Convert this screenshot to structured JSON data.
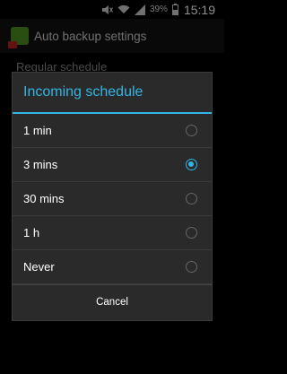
{
  "status_bar": {
    "battery_percent": "39%",
    "time": "15:19",
    "icons": [
      "mute-icon",
      "wifi-icon",
      "signal-icon",
      "battery-icon"
    ]
  },
  "action_bar": {
    "title": "Auto backup settings",
    "icon": "app-icon"
  },
  "background": {
    "item": "Regular schedule"
  },
  "dialog": {
    "title": "Incoming schedule",
    "options": [
      {
        "label": "1 min",
        "selected": false
      },
      {
        "label": "3 mins",
        "selected": true
      },
      {
        "label": "30 mins",
        "selected": false
      },
      {
        "label": "1 h",
        "selected": false
      },
      {
        "label": "Never",
        "selected": false
      }
    ],
    "cancel_label": "Cancel"
  },
  "colors": {
    "accent": "#33b5e5",
    "dialog_bg": "#2a2a2a"
  }
}
